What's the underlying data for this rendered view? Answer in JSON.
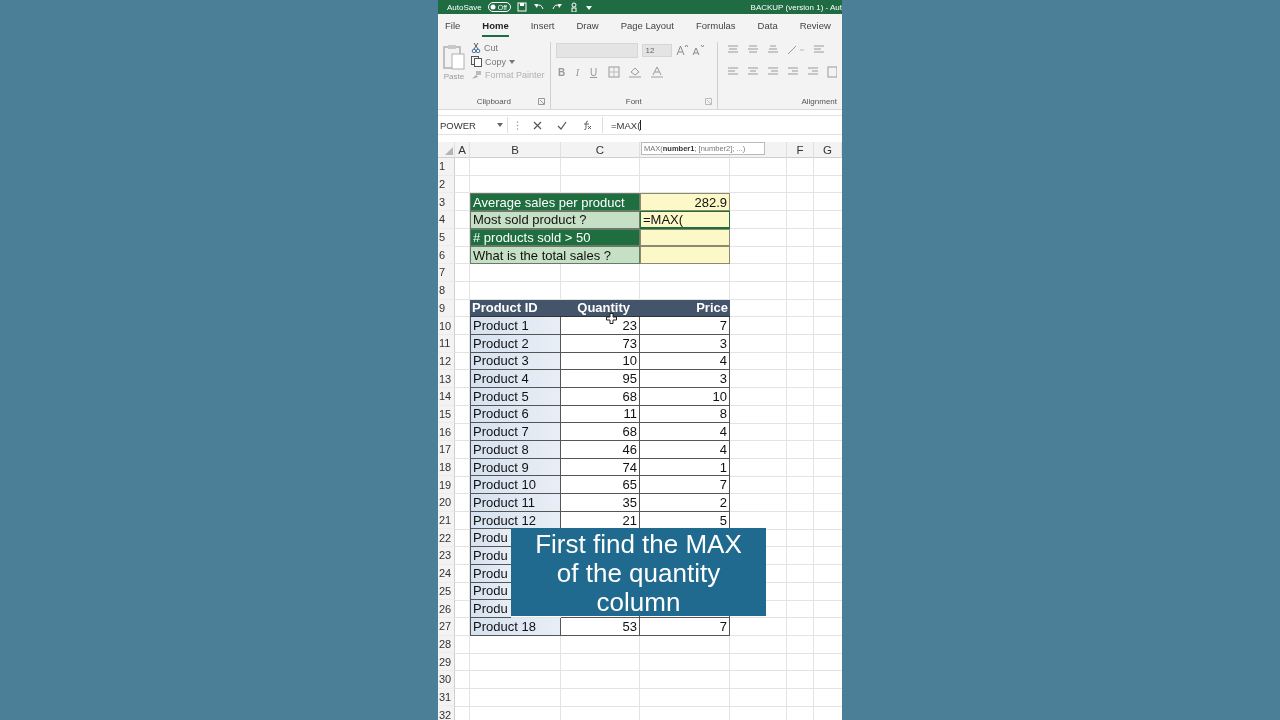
{
  "title_bar": {
    "autosave_label": "AutoSave",
    "autosave_toggle": {
      "label": "Off",
      "on": false
    },
    "title": "BACKUP (version 1) - Aut"
  },
  "ribbon_tabs": [
    {
      "label": "File",
      "selected": false
    },
    {
      "label": "Home",
      "selected": true
    },
    {
      "label": "Insert",
      "selected": false
    },
    {
      "label": "Draw",
      "selected": false
    },
    {
      "label": "Page Layout",
      "selected": false
    },
    {
      "label": "Formulas",
      "selected": false
    },
    {
      "label": "Data",
      "selected": false
    },
    {
      "label": "Review",
      "selected": false
    }
  ],
  "ribbon": {
    "disabled": true,
    "clipboard": {
      "label": "Clipboard",
      "paste": "Paste",
      "cut": "Cut",
      "copy": "Copy",
      "format_painter": "Format Painter"
    },
    "font": {
      "label": "Font",
      "size": "12",
      "bold": "B",
      "italic": "I",
      "underline": "U"
    },
    "alignment": {
      "label": "Alignment"
    }
  },
  "formula_bar": {
    "name_box": "POWER",
    "formula": "=MAX("
  },
  "tooltip": "MAX(**number1**; [number2]; ...)",
  "columns": [
    {
      "header": "A"
    },
    {
      "header": "B"
    },
    {
      "header": "C"
    },
    {},
    {},
    {
      "header": "F"
    },
    {
      "header": "G"
    }
  ],
  "row_numbers": [
    "1",
    "2",
    "3",
    "4",
    "5",
    "6",
    "7",
    "8",
    "9",
    "10",
    "11",
    "12",
    "13",
    "14",
    "15",
    "16",
    "17",
    "18",
    "19",
    "20",
    "21",
    "22",
    "23",
    "24",
    "25",
    "26",
    "27",
    "28",
    "29",
    "30",
    "31",
    "32"
  ],
  "summary": [
    {
      "label": "Average sales per product",
      "value": "282.9",
      "kind": "dark",
      "active": false
    },
    {
      "label": "Most sold product ?",
      "value": "=MAX(",
      "kind": "light",
      "active": true
    },
    {
      "label": "# products sold > 50",
      "kind": "dark",
      "active": false
    },
    {
      "label": "What is the total sales ?",
      "kind": "light",
      "active": false
    }
  ],
  "product_table": {
    "header": [
      "Product ID",
      "Quantity",
      "Price"
    ],
    "rows": [
      {
        "id": "Product 1",
        "quantity": "23",
        "price": "7"
      },
      {
        "id": "Product 2",
        "quantity": "73",
        "price": "3"
      },
      {
        "id": "Product 3",
        "quantity": "10",
        "price": "4"
      },
      {
        "id": "Product 4",
        "quantity": "95",
        "price": "3"
      },
      {
        "id": "Product 5",
        "quantity": "68",
        "price": "10"
      },
      {
        "id": "Product 6",
        "quantity": "11",
        "price": "8"
      },
      {
        "id": "Product 7",
        "quantity": "68",
        "price": "4"
      },
      {
        "id": "Product 8",
        "quantity": "46",
        "price": "4"
      },
      {
        "id": "Product 9",
        "quantity": "74",
        "price": "1"
      },
      {
        "id": "Product 10",
        "quantity": "65",
        "price": "7"
      },
      {
        "id": "Product 11",
        "quantity": "35",
        "price": "2"
      },
      {
        "id": "Product 12",
        "quantity": "21",
        "price": "5"
      },
      {
        "id": "Produ"
      },
      {
        "id": "Produ"
      },
      {
        "id": "Produ"
      },
      {
        "id": "Produ"
      },
      {
        "id": "Produ"
      },
      {
        "id": "Product 18",
        "quantity": "53",
        "price": "7"
      }
    ]
  },
  "caption": "First find the MAX\nof the quantity\ncolumn"
}
